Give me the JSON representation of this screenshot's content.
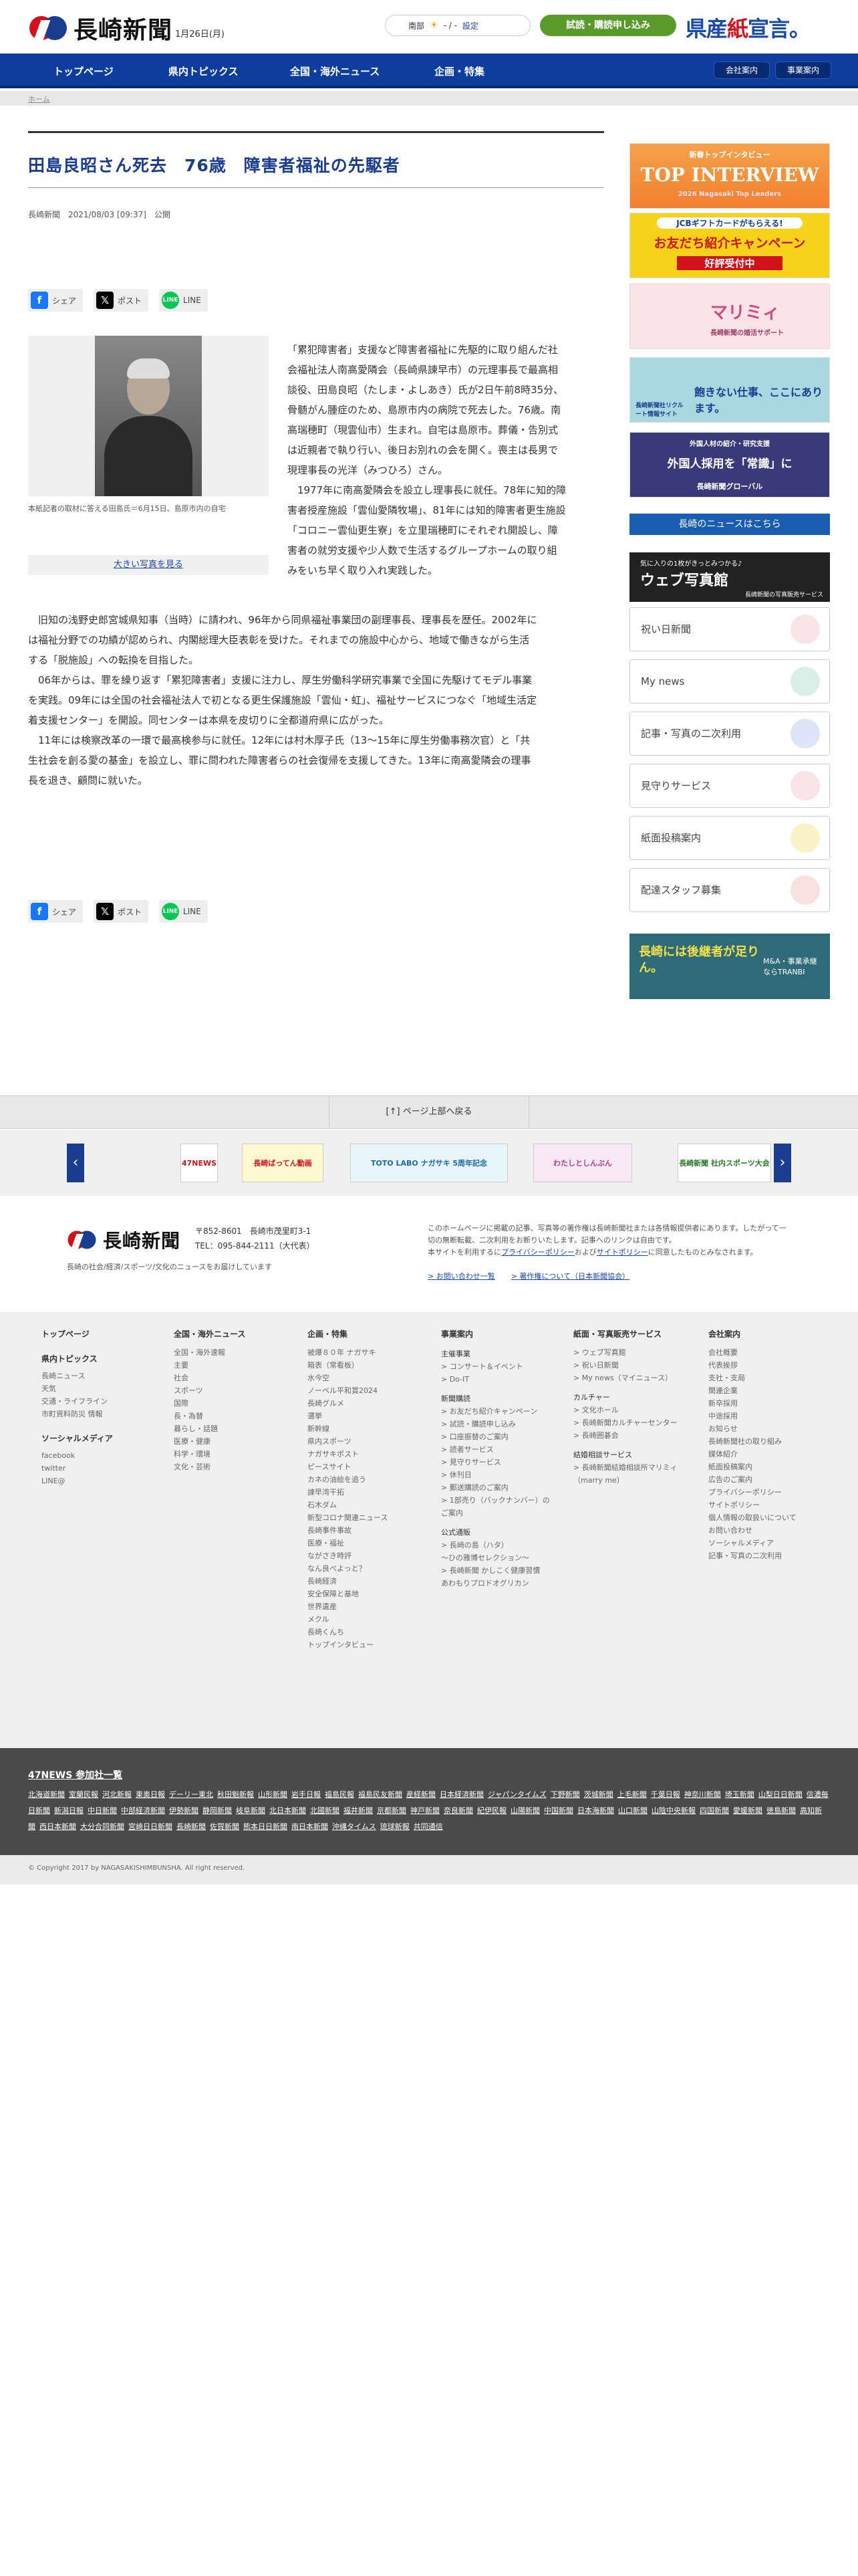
{
  "header": {
    "logo": "長崎新聞",
    "date": "1月26日(月)",
    "weather_region": "南部",
    "weather_temp": "- / -",
    "weather_set": "設定",
    "trial_button": "試読・購読申し込み",
    "slogan_a": "県産",
    "slogan_b": "紙",
    "slogan_c": "宣言。"
  },
  "nav": {
    "items": [
      "トップページ",
      "県内トピックス",
      "全国・海外ニュース",
      "企画・特集"
    ],
    "right": [
      "会社案内",
      "事業案内"
    ]
  },
  "breadcrumb": "ホーム",
  "article": {
    "title": "田島良昭さん死去　76歳　障害者福祉の先駆者",
    "meta": "長崎新聞　2021/08/03 [09:37]　公開",
    "share": [
      "シェア",
      "ポスト",
      "LINE"
    ],
    "caption": "本紙記者の取材に答える田島氏＝6月15日、島原市内の自宅",
    "bigphoto": "大きい写真を見る",
    "p1_lines": [
      "「累犯障害者」支援など障害者福祉に先駆的に取り組んだ社",
      "会福祉法人南高愛隣会（長崎県諫早市）の元理事長で最高相",
      "談役、田島良昭（たしま・よしあき）氏が2日午前8時35分、",
      "骨髄がん腫症のため、島原市内の病院で死去した。76歳。南",
      "高瑞穂町（現雲仙市）生まれ。自宅は島原市。葬儀・告別式",
      "は近親者で執り行い、後日お別れの会を開く。喪主は長男で",
      "現理事長の光洋（みつひろ）さん。",
      "　1977年に南高愛隣会を設立し理事長に就任。78年に知的障",
      "害者授産施設「雲仙愛隣牧場」、81年には知的障害者更生施設",
      "「コロニー雲仙更生寮」を立里瑞穂町にそれぞれ開設し、障",
      "害者の就労支援や少人数で生活するグループホームの取り組",
      "みをいち早く取り入れ実践した。"
    ],
    "p2_lines": [
      "　旧知の浅野史郎宮城県知事（当時）に請われ、96年から同県福祉事業団の副理事長、理事長を歴任。2002年に",
      "は福祉分野での功績が認められ、内閣総理大臣表彰を受けた。それまでの施設中心から、地域で働きながら生活",
      "する「脱施設」への転換を目指した。",
      "　06年からは、罪を繰り返す「累犯障害者」支援に注力し、厚生労働科学研究事業で全国に先駆けてモデル事業",
      "を実践。09年には全国の社会福祉法人で初となる更生保護施設「雲仙・虹」、福祉サービスにつなぐ「地域生活定",
      "着支援センター」を開設。同センターは本県を皮切りに全都道府県に広がった。",
      "　11年には検察改革の一環で最高検参与に就任。12年には村木厚子氏（13～15年に厚生労働事務次官）と「共",
      "生社会を創る愛の基金」を設立し、罪に問われた障害者らの社会復帰を支援してきた。13年に南高愛隣会の理事",
      "長を退き、顧問に就いた。"
    ]
  },
  "sidebar": {
    "ads": [
      {
        "top": "新春トップインタビュー",
        "main": "TOP INTERVIEW",
        "sub": "2026 Nagasaki Top Leaders"
      },
      {
        "top": "JCBギフトカードがもらえる!",
        "main": "お友だち紹介キャンペーン",
        "sub": "好評受付中"
      },
      {
        "top": "",
        "main": "マリミィ",
        "sub": "長崎新聞の婚活サポート"
      },
      {
        "top": "長崎新聞社リクルート情報サイト",
        "main": "飽きない仕事、ここにあります。",
        "sub": ""
      },
      {
        "top": "外国人材の紹介・研究支援",
        "main": "外国人採用を「常識」に",
        "sub": "長崎新聞グローバル"
      }
    ],
    "news_button": "長崎のニュースはこちら",
    "webphoto_top": "気に入りの1枚がきっとみつかる♪",
    "webphoto_main": "ウェブ写真館",
    "webphoto_sub": "長崎新聞の写真販売サービス",
    "boxes": [
      "祝い日新聞",
      "My news",
      "記事・写真の二次利用",
      "見守りサービス",
      "紙面投稿案内",
      "配達スタッフ募集"
    ],
    "tranbi_main": "長崎には後継者が足りん。",
    "tranbi_sub": "M&A・事業承継ならTRANBI"
  },
  "pagetop": "[↑] ページ上部へ戻る",
  "banners": [
    "47NEWS",
    "長崎ばってん動画",
    "TOTO LABO ナガサキ 5周年記念",
    "わたしとしんぶん",
    "長崎新聞 社内スポーツ大会"
  ],
  "footer": {
    "logo": "長崎新聞",
    "postal": "〒852-8601　長崎市茂里町3-1",
    "tel": "TEL：095-844-2111（大代表）",
    "tagline": "長崎の社会/経済/スポーツ/文化のニュースをお届けしています",
    "copy1": "このホームページに掲載の記事、写真等の著作権は長崎新聞社または各情報提供者にあります。したがって一切の無断転載、二次利用をお断りいたします。記事へのリンクは自由です。",
    "copy2_a": "本サイトを利用するに",
    "copy2_b": "プライバシーポリシー",
    "copy2_c": "および",
    "copy2_d": "サイトポリシー",
    "copy2_e": "に同意したものとみなされます。",
    "link1": "> お問い合わせ一覧",
    "link2": "> 著作権について（日本新聞協会）",
    "col1": {
      "h": "トップページ",
      "h2": "県内トピックス",
      "items": [
        "長崎ニュース",
        "天気",
        "交通・ライフライン",
        "市町資料防災 情報"
      ],
      "h3": "ソーシャルメディア",
      "items2": [
        "facebook",
        "twitter",
        "LINE@"
      ]
    },
    "col2": {
      "h": "全国・海外ニュース",
      "items": [
        "全国・海外速報",
        "主要",
        "社会",
        "スポーツ",
        "国際",
        "長・為替",
        "暮らし・話題",
        "医療・健康",
        "科学・環境",
        "文化・芸術"
      ]
    },
    "col3": {
      "h": "企画・特集",
      "items": [
        "被爆８０年 ナガサキ",
        "箱表（常看板）",
        "水今空",
        "ノーベル平和賞2024",
        "長崎グルメ",
        "選挙",
        "新幹線",
        "県内スポーツ",
        "ナガサキポスト",
        "ピースサイト",
        "カネの油絵を追う",
        "諫早湾干拓",
        "石木ダム",
        "新型コロナ関連ニュース",
        "長崎事件事故",
        "医療・福祉",
        "ながさき時評",
        "なん良べよっと？",
        "長崎経済",
        "安全保障と基地",
        "世界遺産",
        "メクル",
        "長崎くんち",
        "トップインタビュー"
      ]
    },
    "col4": {
      "h": "事業案内",
      "s1": "主催事業",
      "s1i": [
        "> コンサート＆イベント",
        "> Do-IT"
      ],
      "s2": "新聞購読",
      "s2i": [
        "> お友だち紹介キャンペーン",
        "> 試読・購読申し込み",
        "> 口座振替のご案内",
        "> 読者サービス",
        "> 見守りサービス",
        "> 休刊日",
        "> 郵送購読のご案内",
        "> 1部売り（バックナンバー）のご案内"
      ],
      "s3": "公式通販",
      "s3i": [
        "> 長崎の島（ハタ）",
        "～ひの雅博セレクション～",
        "> 長崎新聞 かしこく健康習慣",
        "あわもりプロドオグリカン"
      ]
    },
    "col5": {
      "h": "紙面・写真販売サービス",
      "items": [
        "> ウェブ写真館",
        "> 祝い日新聞",
        "> My news（マイニュース）"
      ],
      "s2": "カルチャー",
      "s2i": [
        "> 文化ホール",
        "> 長崎新聞カルチャーセンター",
        "> 長崎囲碁会"
      ],
      "s3": "結婚相談サービス",
      "s3i": [
        "> 長崎新聞結婚相談所マリミィ（marry me）"
      ]
    },
    "col6": {
      "h": "会社案内",
      "items": [
        "会社概要",
        "代表挨拶",
        "支社・支局",
        "関連企業",
        "新卒採用",
        "中途採用",
        "お知らせ",
        "長崎新聞社の取り組み",
        "媒体紹介",
        "紙面投稿案内",
        "広告のご案内",
        "プライバシーポリシー",
        "サイトポリシー",
        "個人情報の取扱いについて",
        "お問い合わせ",
        "ソーシャルメディア",
        "記事・写真の二次利用"
      ]
    }
  },
  "news47": {
    "title": "47NEWS 参加社一覧",
    "papers": [
      "北海道新聞",
      "室蘭民報",
      "河北新報",
      "東奥日報",
      "デーリー東北",
      "秋田魁新報",
      "山形新聞",
      "岩手日報",
      "福島民報",
      "福島民友新聞",
      "産経新聞",
      "日本経済新聞",
      "ジャパンタイムズ",
      "下野新聞",
      "茨城新聞",
      "上毛新聞",
      "千葉日報",
      "神奈川新聞",
      "埼玉新聞",
      "山梨日日新聞",
      "信濃毎日新聞",
      "新潟日報",
      "中日新聞",
      "中部経済新聞",
      "伊勢新聞",
      "静岡新聞",
      "岐阜新聞",
      "北日本新聞",
      "北國新聞",
      "福井新聞",
      "京都新聞",
      "神戸新聞",
      "奈良新聞",
      "紀伊民報",
      "山陽新聞",
      "中国新聞",
      "日本海新聞",
      "山口新聞",
      "山陰中央新報",
      "四国新聞",
      "愛媛新聞",
      "徳島新聞",
      "高知新聞",
      "西日本新聞",
      "大分合同新聞",
      "宮崎日日新聞",
      "長崎新聞",
      "佐賀新聞",
      "熊本日日新聞",
      "南日本新聞",
      "沖縄タイムス",
      "琉球新報",
      "共同通信"
    ]
  },
  "copyright": "© Copyright 2017 by NAGASAKISHIMBUNSHA. All right reserved.",
  "colors": {
    "brand_blue": "#0d3e9e",
    "title_blue": "#1a3d8f",
    "brand_red": "#d0121b",
    "trial_green": "#5a9a2a"
  }
}
